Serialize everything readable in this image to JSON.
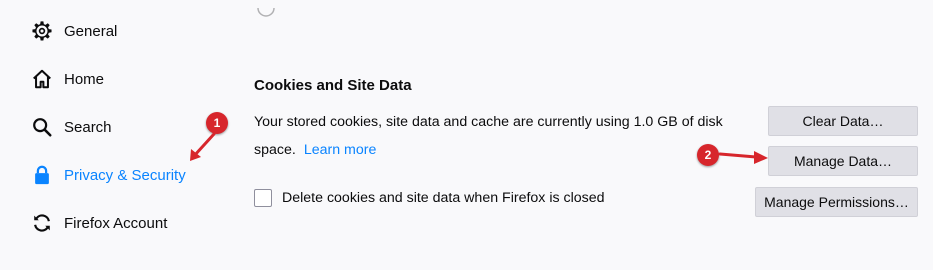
{
  "sidebar": {
    "items": [
      {
        "label": "General",
        "icon": "gear-icon"
      },
      {
        "label": "Home",
        "icon": "home-icon"
      },
      {
        "label": "Search",
        "icon": "search-icon"
      },
      {
        "label": "Privacy & Security",
        "icon": "lock-icon",
        "selected": true
      },
      {
        "label": "Firefox Account",
        "icon": "sync-icon"
      }
    ]
  },
  "cookies": {
    "title": "Cookies and Site Data",
    "description": "Your stored cookies, site data and cache are currently using 1.0 GB of disk space.",
    "learn_more": "Learn more",
    "clear_data": "Clear Data…",
    "manage_data": "Manage Data…",
    "manage_permissions": "Manage Permissions…",
    "delete_on_close_label": "Delete cookies and site data when Firefox is closed",
    "delete_on_close_checked": false
  },
  "annotations": {
    "marker_1": "1",
    "marker_2": "2",
    "color": "#d7262c"
  },
  "colors": {
    "accent": "#0a84ff",
    "button_bg": "#e0e0e6",
    "background": "#f9f9fb"
  }
}
